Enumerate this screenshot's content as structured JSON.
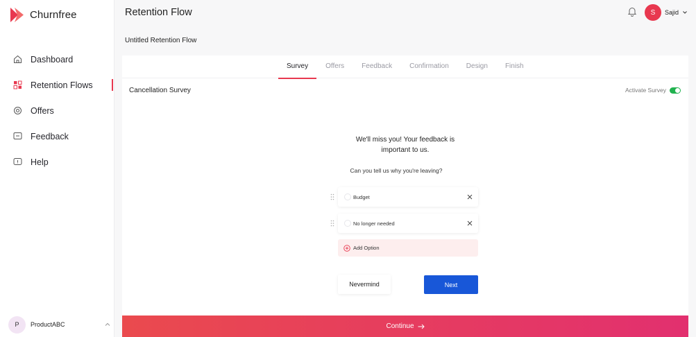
{
  "brand": {
    "name": "Churnfree",
    "accent": "#e8384f"
  },
  "sidebar": {
    "items": [
      {
        "label": "Dashboard",
        "icon": "home-icon"
      },
      {
        "label": "Retention Flows",
        "icon": "flows-icon",
        "active": true
      },
      {
        "label": "Offers",
        "icon": "offers-icon"
      },
      {
        "label": "Feedback",
        "icon": "feedback-icon"
      },
      {
        "label": "Help",
        "icon": "help-icon"
      }
    ],
    "workspace": {
      "initial": "P",
      "name": "ProductABC"
    }
  },
  "header": {
    "title": "Retention Flow",
    "user": {
      "initial": "S",
      "name": "Sajid"
    }
  },
  "flow": {
    "name": "Untitled Retention Flow"
  },
  "tabs": [
    {
      "label": "Survey",
      "active": true
    },
    {
      "label": "Offers"
    },
    {
      "label": "Feedback"
    },
    {
      "label": "Confirmation"
    },
    {
      "label": "Design"
    },
    {
      "label": "Finish"
    }
  ],
  "survey": {
    "section_title": "Cancellation Survey",
    "activate_label": "Activate Survey",
    "activated": true,
    "headline": "We'll miss you! Your feedback is important to us.",
    "question": "Can you tell us why you're leaving?",
    "options": [
      "Budget",
      "No longer needed"
    ],
    "add_option_label": "Add Option",
    "nevermind_label": "Nevermind",
    "next_label": "Next"
  },
  "footer": {
    "continue_label": "Continue"
  }
}
